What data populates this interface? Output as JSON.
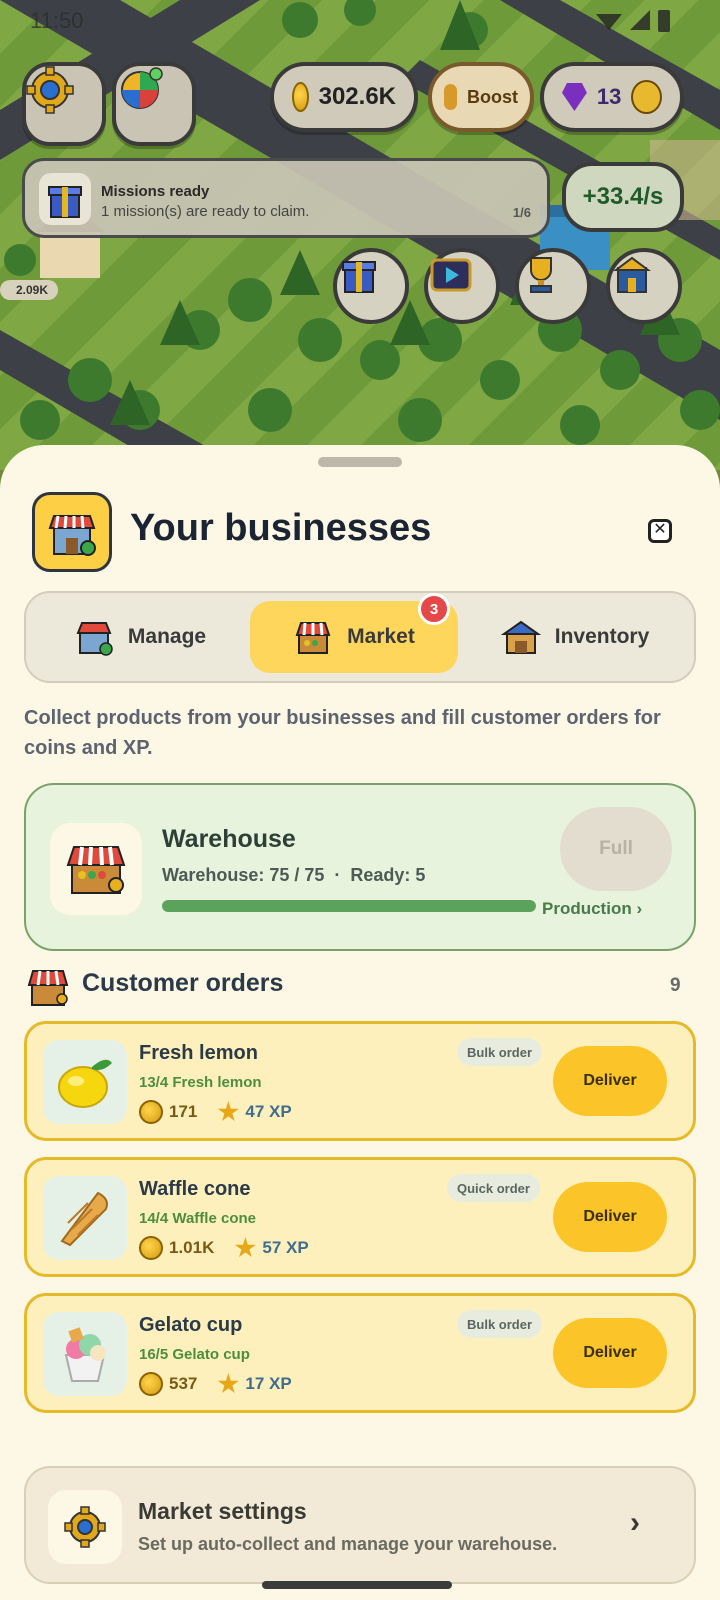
{
  "status_bar": {
    "time": "11:50"
  },
  "hud": {
    "coins": "302.6K",
    "boost_label": "Boost",
    "gems": "13",
    "mission": {
      "title": "Missions ready",
      "subtitle": "1 mission(s) are ready to claim.",
      "count": "1/6"
    },
    "rate": "+33.4/s",
    "map_label": "2.09K"
  },
  "sheet": {
    "title": "Your businesses",
    "close_label": "✕",
    "tabs": [
      {
        "label": "Manage"
      },
      {
        "label": "Market",
        "badge": "3"
      },
      {
        "label": "Inventory"
      }
    ],
    "description": "Collect products from your businesses and fill customer orders for coins and XP.",
    "warehouse": {
      "title": "Warehouse",
      "status": "Warehouse: 75 / 75  ·  Ready: 5",
      "fill_fraction": 1.0,
      "full_label": "Full",
      "production_label": "Production ›"
    },
    "orders_header": "Customer orders",
    "orders_count": "9",
    "orders": [
      {
        "name": "Fresh lemon",
        "progress": "13/4 Fresh lemon",
        "coins": "171",
        "xp": "47 XP",
        "tag": "Bulk order",
        "deliver": "Deliver",
        "icon": "lemon-icon"
      },
      {
        "name": "Waffle cone",
        "progress": "14/4 Waffle cone",
        "coins": "1.01K",
        "xp": "57 XP",
        "tag": "Quick order",
        "deliver": "Deliver",
        "icon": "waffle-cone-icon"
      },
      {
        "name": "Gelato cup",
        "progress": "16/5 Gelato cup",
        "coins": "537",
        "xp": "17 XP",
        "tag": "Bulk order",
        "deliver": "Deliver",
        "icon": "gelato-cup-icon"
      }
    ],
    "settings": {
      "title": "Market settings",
      "subtitle": "Set up auto-collect and manage your warehouse.",
      "chevron": "›"
    }
  },
  "colors": {
    "accent_yellow": "#fdd65b",
    "deliver_yellow": "#fbc52a",
    "badge_red": "#e54848",
    "warehouse_green": "#5ba35c"
  }
}
